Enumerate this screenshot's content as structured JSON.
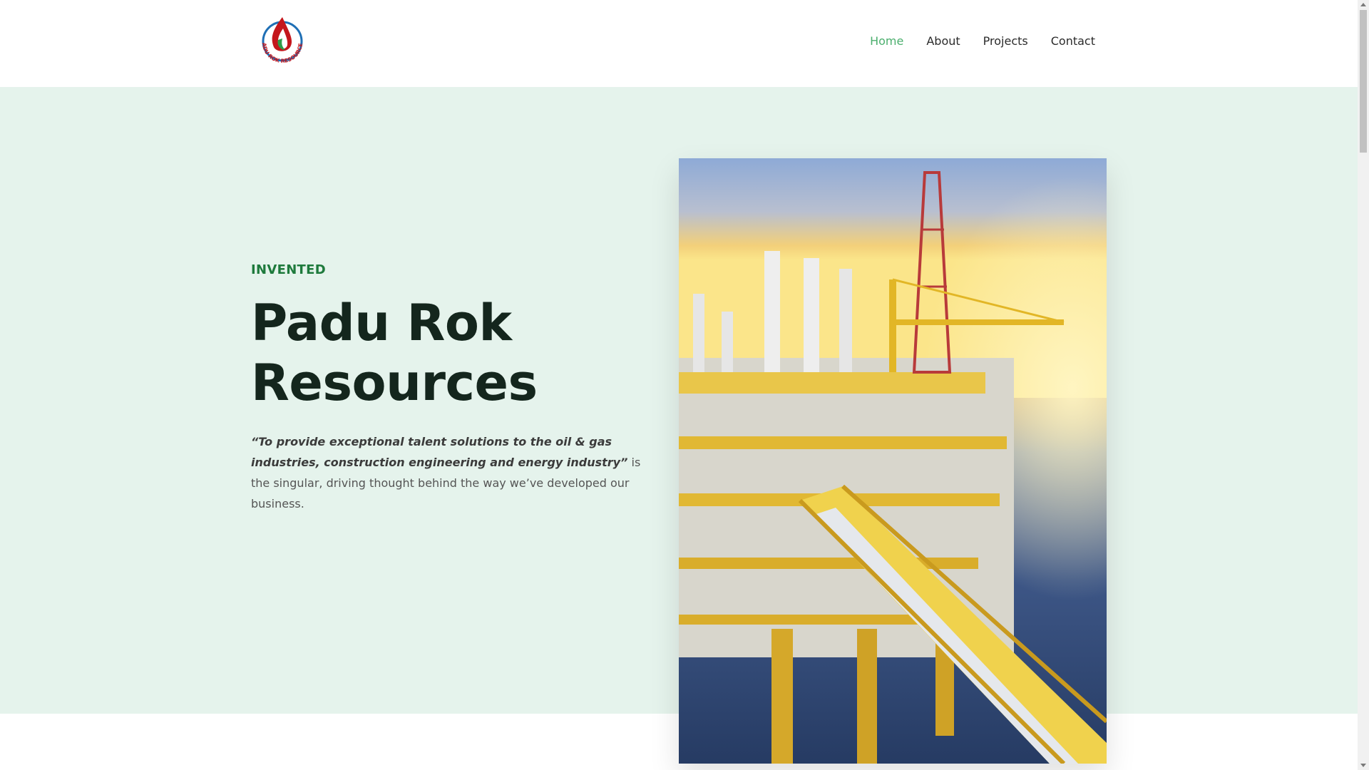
{
  "header": {
    "logo_text": "PADU ROK RESOURCES",
    "nav": [
      {
        "label": "Home",
        "active": true
      },
      {
        "label": "About",
        "active": false
      },
      {
        "label": "Projects",
        "active": false
      },
      {
        "label": "Contact",
        "active": false
      }
    ]
  },
  "hero": {
    "eyebrow": "INVENTED",
    "title_line1": "Padu Rok",
    "title_line2": "Resources",
    "quote": "“To provide exceptional talent solutions to the oil & gas industries, construction engineering and energy industry”",
    "description_rest": " is the singular, driving thought behind the way we’ve developed our business.",
    "image_subject": "offshore-oil-platform-at-sunset"
  },
  "colors": {
    "accent_green": "#4caf6e",
    "eyebrow_green": "#1e7a3c",
    "hero_bg": "#e5f3ec",
    "title_dark": "#14261d"
  }
}
